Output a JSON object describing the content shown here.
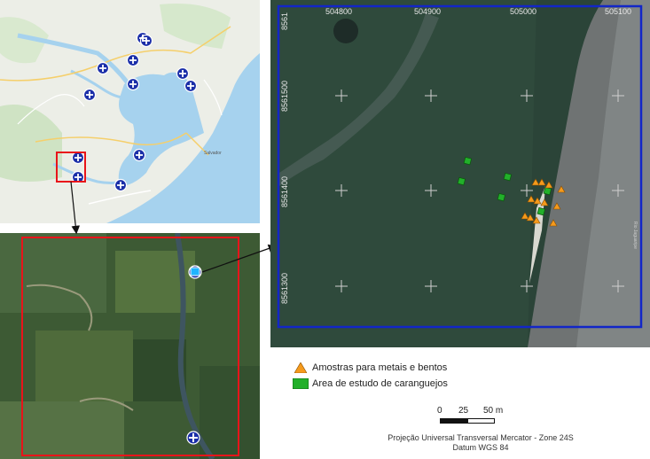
{
  "legend": {
    "metals_label": "Amostras para metais e bentos",
    "crab_label": "Area de estudo de caranguejos",
    "metals_color": "#f59a1c",
    "crab_color": "#22b02a"
  },
  "scale_bar": {
    "tick_0": "0",
    "tick_25": "25",
    "tick_50": "50 m"
  },
  "projection": {
    "line1": "Projeção Universal Transversal Mercator - Zone 24S",
    "line2": "Datum WGS 84"
  },
  "grid_labels": {
    "x1": "504800",
    "x2": "504900",
    "x3": "505000",
    "x4": "505100",
    "y_top": "8561",
    "y1": "8561500",
    "y2": "8561400",
    "y3": "8561300"
  },
  "map_text": {
    "city_label": "Salvador",
    "edge_label": "Rio Jaguaripe"
  },
  "colors": {
    "frame_red": "#e8141a",
    "frame_blue": "#1226c8",
    "marker_blue": "#1a2ea8",
    "bay_water": "#a6d2ee"
  }
}
